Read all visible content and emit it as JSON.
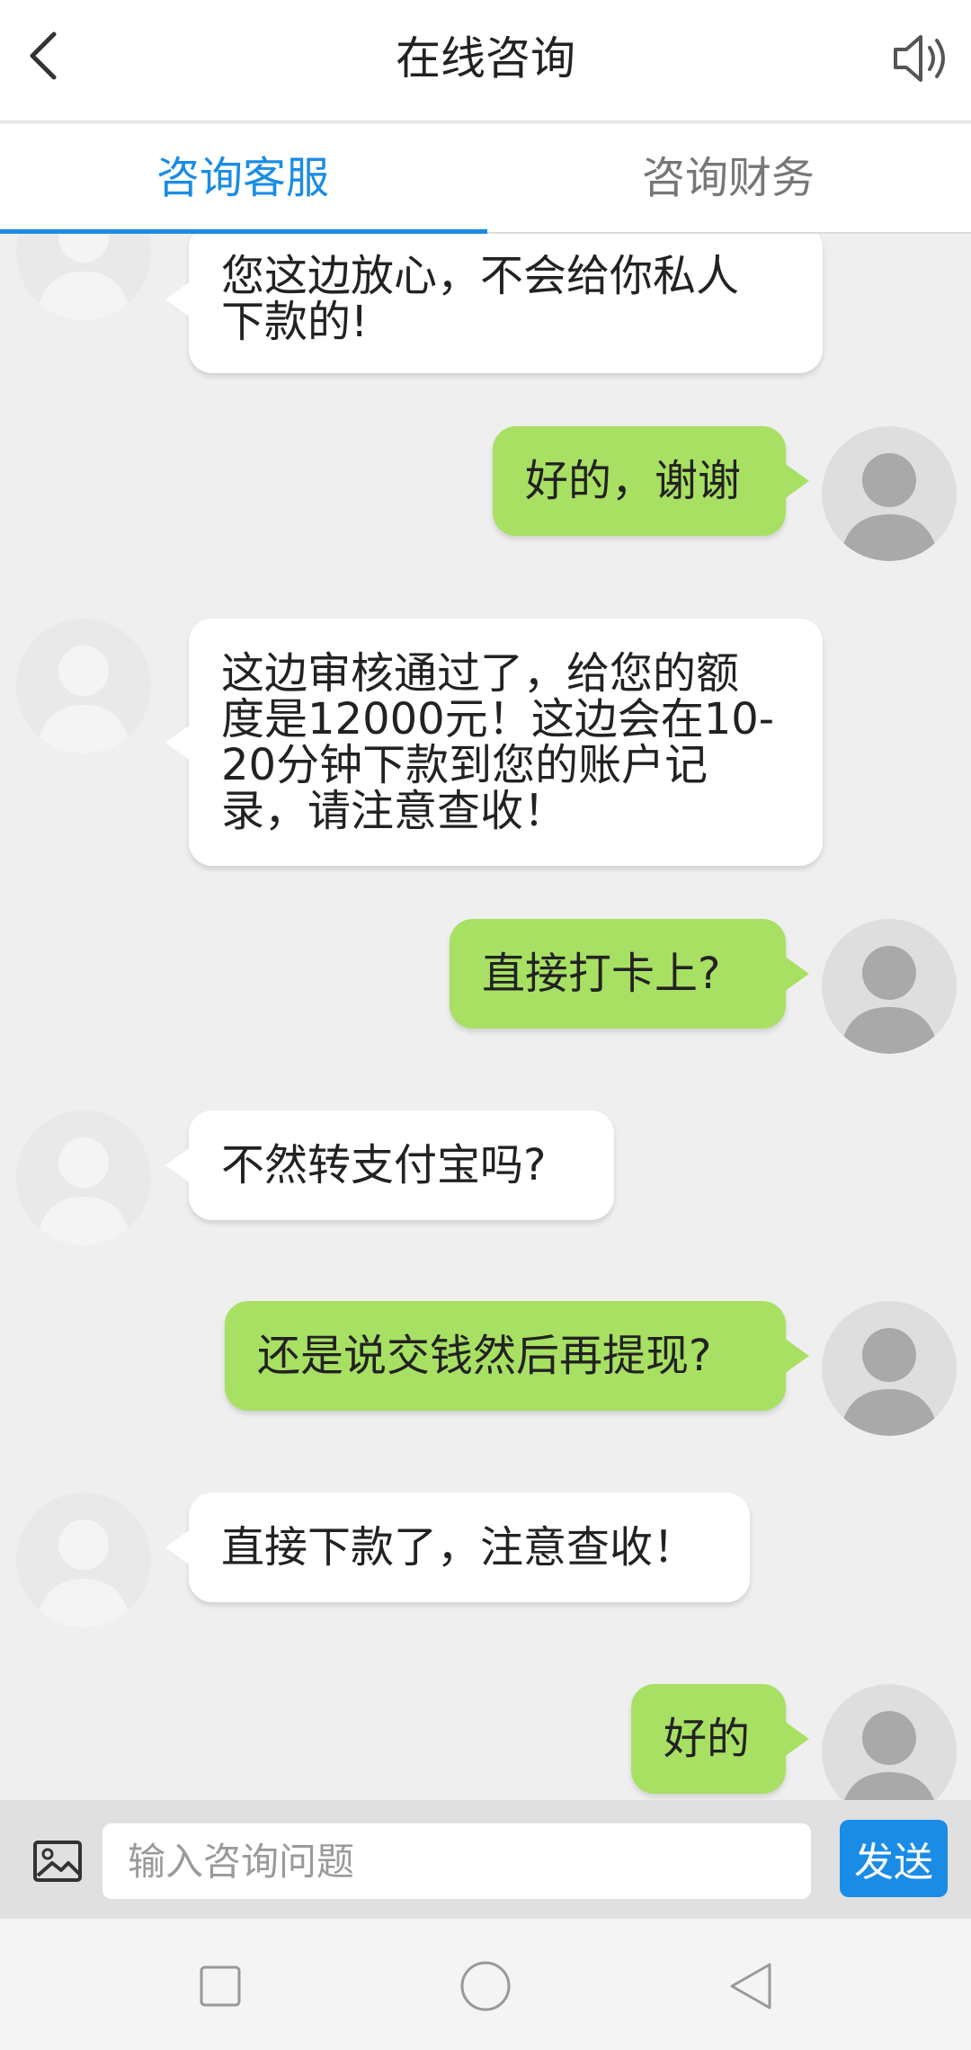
{
  "theme": {
    "accent": "#1a8ce5",
    "user_bubble": "#a8e063"
  },
  "header": {
    "title": "在线咨询",
    "back_icon": "chevron-left-icon",
    "sound_icon": "speaker-icon"
  },
  "tabs": [
    {
      "label": "咨询客服",
      "active": true
    },
    {
      "label": "咨询财务",
      "active": false
    }
  ],
  "messages": [
    {
      "sender": "agent",
      "lines": [
        "您这边放心，不会给你私人",
        "下款的!"
      ]
    },
    {
      "sender": "user",
      "lines": [
        "好的，谢谢"
      ]
    },
    {
      "sender": "agent",
      "lines": [
        "这边审核通过了，给您的额",
        "度是12000元！这边会在10-",
        "20分钟下款到您的账户记",
        "录，请注意查收！"
      ]
    },
    {
      "sender": "user",
      "lines": [
        "直接打卡上?"
      ]
    },
    {
      "sender": "agent",
      "lines": [
        "不然转支付宝吗?"
      ]
    },
    {
      "sender": "user",
      "lines": [
        "还是说交钱然后再提现?"
      ]
    },
    {
      "sender": "agent",
      "lines": [
        "直接下款了，注意查收！"
      ]
    },
    {
      "sender": "user",
      "lines": [
        "好的"
      ]
    }
  ],
  "input": {
    "placeholder": "输入咨询问题",
    "value": "",
    "image_icon": "image-icon"
  },
  "send_label": "发送",
  "nav": {
    "square_icon": "recent-apps-icon",
    "circle_icon": "home-icon",
    "triangle_icon": "back-triangle-icon"
  }
}
